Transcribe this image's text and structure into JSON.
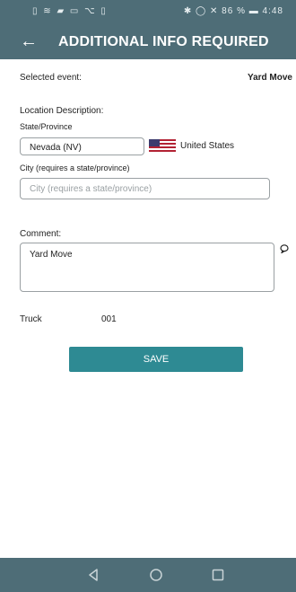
{
  "status_bar": {
    "left": "▯ ≋ ▰ ▭ ⌥ ▯",
    "right": "✱ ◯ ✕ 86 % ▬ 4:48"
  },
  "header": {
    "title": "ADDITIONAL INFO REQUIRED"
  },
  "form": {
    "selected_event_label": "Selected event:",
    "selected_event_value": "Yard Move",
    "location_description_label": "Location Description:",
    "state_label": "State/Province",
    "state_value": "Nevada (NV)",
    "country_value": "United States",
    "city_label": "City (requires a state/province)",
    "city_placeholder": "City (requires a state/province)",
    "comment_label": "Comment:",
    "comment_value": "Yard Move",
    "truck_label": "Truck",
    "truck_value": "001",
    "save_label": "SAVE"
  }
}
